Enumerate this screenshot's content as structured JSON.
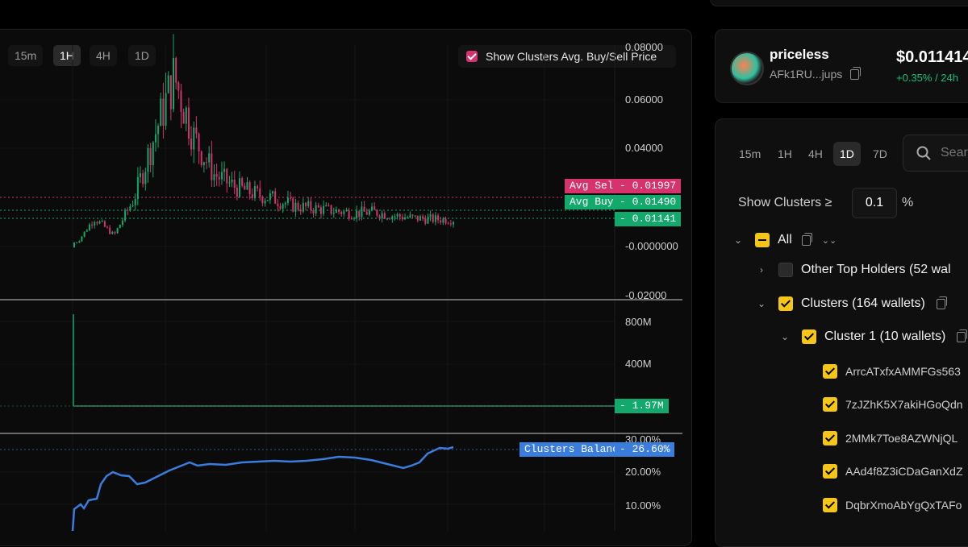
{
  "chart": {
    "timeframes": [
      "15m",
      "1H",
      "4H",
      "1D"
    ],
    "active_timeframe": "1H",
    "show_clusters_label": "Show Clusters Avg. Buy/Sell Price",
    "price_axis": [
      "0.08000",
      "0.06000",
      "0.04000",
      "-0.0000000",
      "-0.02000"
    ],
    "volume_axis": [
      "800M",
      "400M"
    ],
    "balance_axis": [
      "30.00%",
      "20.00%",
      "10.00%"
    ],
    "avg_sell": {
      "label": "Avg Sell",
      "value": "0.01997",
      "color": "#d6336c"
    },
    "avg_buy": {
      "label": "Avg Buy",
      "value": "0.01490",
      "color": "#13a86c"
    },
    "last_price": "0.01141",
    "last_volume": "1.97M",
    "clusters_balance": {
      "label": "Clusters Balance",
      "value": "26.60%",
      "color": "#3b7ddd"
    }
  },
  "chart_data": {
    "type": "line",
    "title": "",
    "series": [
      {
        "name": "Price",
        "values": [
          0.0,
          0.012,
          0.005,
          0.02,
          0.045,
          0.07,
          0.045,
          0.03,
          0.025,
          0.022,
          0.02,
          0.017,
          0.016,
          0.015,
          0.014,
          0.0145,
          0.013,
          0.012,
          0.0115,
          0.01141
        ]
      },
      {
        "name": "Clusters Balance",
        "values": [
          0,
          4,
          9,
          18,
          16,
          19,
          22,
          23,
          23.5,
          24,
          24.5,
          25,
          24,
          23,
          24.5,
          26.6
        ]
      }
    ],
    "ylim": [
      -0.02,
      0.08
    ]
  },
  "token": {
    "name": "priceless",
    "address": "AFk1RU...jups",
    "price": "$0.011414",
    "change": "+0.35% / 24h"
  },
  "clusters_panel": {
    "timeframes": [
      "15m",
      "1H",
      "4H",
      "1D",
      "7D"
    ],
    "active_timeframe": "1D",
    "search_placeholder": "Sear",
    "threshold_label": "Show Clusters ≥",
    "threshold_value": "0.1",
    "threshold_unit": "%",
    "tree": {
      "all": "All",
      "other": "Other Top Holders (52 wal",
      "clusters": "Clusters (164 wallets)",
      "cluster1": "Cluster 1 (10 wallets)"
    },
    "wallets": [
      "ArrcATxfxAMMFGs563",
      "7zJZhK5X7akiHGoQdn",
      "2MMk7Toe8AZWNjQL",
      "AAd4f8Z3iCDaGanXdZ",
      "DqbrXmoAbYgQxTAFo"
    ]
  }
}
